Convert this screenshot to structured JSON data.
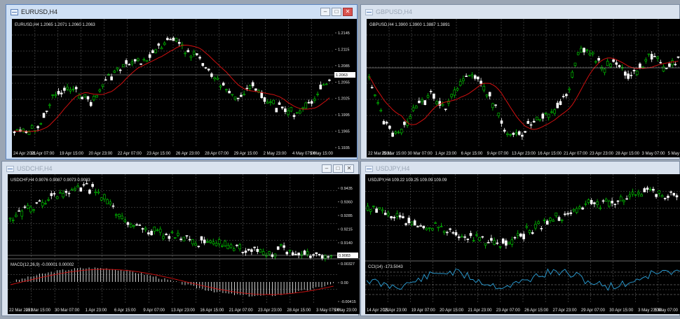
{
  "windows": {
    "eurusd": {
      "title": "EURUSD,H4",
      "header": "EURUSD,H4  1.2065 1.2071 1.2060 1.2063",
      "price_labels": [
        "1.2145",
        "1.2115",
        "1.2085",
        "1.2055",
        "1.2025",
        "1.1995",
        "1.1965",
        "1.1935"
      ],
      "current_price": "1.2063",
      "time_labels": [
        "24 Apr 2021",
        "16 Apr 07:00",
        "19 Apr 15:00",
        "20 Apr 23:00",
        "22 Apr 07:00",
        "23 Apr 15:00",
        "26 Apr 23:00",
        "28 Apr 07:00",
        "29 Apr 15:00",
        "2 May 23:00",
        "4 May 07:00",
        "5 May 15:00"
      ]
    },
    "gbpusd": {
      "title": "GBPUSD,H4",
      "header": "GBPUSD,H4  1.3900 1.3900 1.3887 1.3891",
      "time_labels": [
        "22 Mar 2021",
        "25 Mar 15:00",
        "30 Mar 07:00",
        "1 Apr 23:00",
        "6 Apr 15:00",
        "9 Apr 07:00",
        "13 Apr 23:00",
        "16 Apr 15:00",
        "21 Apr 07:00",
        "23 Apr 23:00",
        "28 Apr 15:00",
        "3 May 07:00",
        "5 May"
      ]
    },
    "usdchf": {
      "title": "USDCHF,H4",
      "header": "USDCHF,H4  0.9076 0.9087 0.9073 0.9083",
      "price_labels": [
        "0.9435",
        "0.9360",
        "0.9285",
        "0.9215",
        "0.9140"
      ],
      "current_price": "0.9083",
      "indicator_header": "MACD(12,26,9) -0.00001 0.00002",
      "indicator_labels": [
        "0.00327",
        "0.00",
        "-0.00415"
      ],
      "time_labels": [
        "22 Mar 2021",
        "25 Mar 15:00",
        "30 Mar 07:00",
        "1 Apr 23:00",
        "6 Apr 15:00",
        "9 Apr 07:00",
        "13 Apr 23:00",
        "16 Apr 15:00",
        "21 Apr 07:00",
        "23 Apr 23:00",
        "28 Apr 15:00",
        "3 May 07:00",
        "5 May 23:00"
      ]
    },
    "usdjpy": {
      "title": "USDJPY,H4",
      "header": "USDJPY,H4  109.22 109.25 109.09 109.09",
      "indicator_header": "CCI(14) -173.5043",
      "time_labels": [
        "14 Apr 2021",
        "15 Apr 23:00",
        "19 Apr 07:00",
        "20 Apr 15:00",
        "21 Apr 23:00",
        "23 Apr 07:00",
        "26 Apr 15:00",
        "27 Apr 23:00",
        "29 Apr 07:00",
        "30 Apr 15:00",
        "3 May 23:00",
        "5 May 07:00"
      ]
    }
  },
  "colors": {
    "bullish": "#00d000",
    "bearish": "#ffffff",
    "moving_average": "#d01010",
    "macd_signal": "#d01010",
    "cci_line": "#2aa0d8",
    "grid": "#6a6a6a"
  }
}
